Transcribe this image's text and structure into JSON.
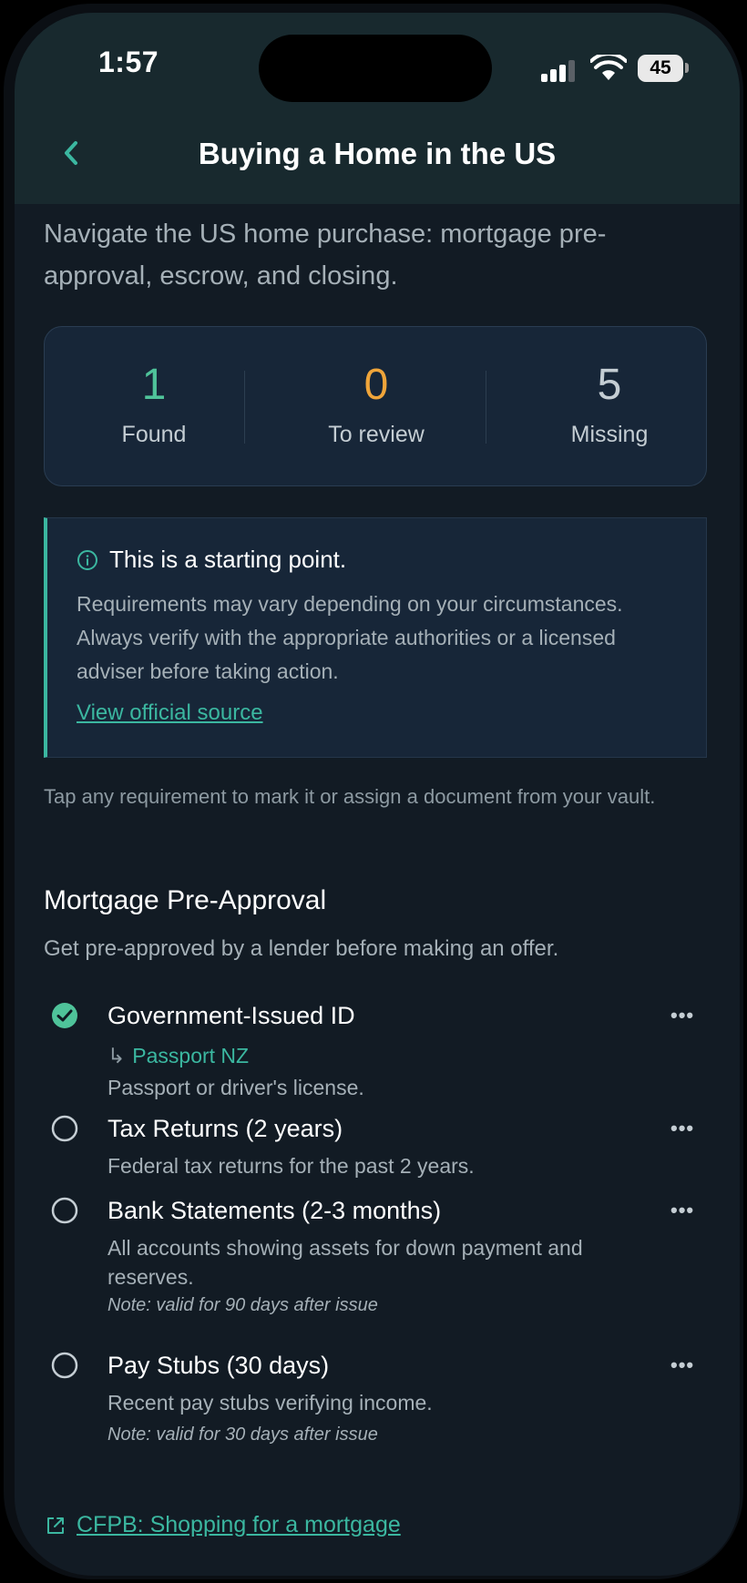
{
  "status_bar": {
    "time": "1:57",
    "battery": "45"
  },
  "header": {
    "title": "Buying a Home in the US"
  },
  "intro": "Navigate the US home purchase: mortgage pre-approval, escrow, and closing.",
  "stats": [
    {
      "value": "1",
      "label": "Found",
      "color": "#4fc39a"
    },
    {
      "value": "0",
      "label": "To review",
      "color": "#f0a53a"
    },
    {
      "value": "5",
      "label": "Missing",
      "color": "#c4cdd3"
    }
  ],
  "notice": {
    "title": "This is a starting point.",
    "body": "Requirements may vary depending on your circumstances. Always verify with the appropriate authorities or a licensed adviser before taking action.",
    "link": "View official source"
  },
  "tap_hint": "Tap any requirement to mark it or assign a document from your vault.",
  "section": {
    "title": "Mortgage Pre-Approval",
    "description": "Get pre-approved by a lender before making an offer.",
    "requirements": [
      {
        "name": "Government-Issued ID",
        "assigned": "Passport NZ",
        "description": "Passport or driver's license.",
        "done": true
      },
      {
        "name": "Tax Returns (2 years)",
        "description": "Federal tax returns for the past 2 years.",
        "done": false
      },
      {
        "name": "Bank Statements (2-3 months)",
        "description": "All accounts showing assets for down payment and reserves.",
        "note": "Note: valid for 90 days after issue",
        "done": false
      },
      {
        "name": "Pay Stubs (30 days)",
        "description": "Recent pay stubs verifying income.",
        "note": "Note: valid for 30 days after issue",
        "done": false
      }
    ]
  },
  "footer_link": "CFPB: Shopping for a mortgage",
  "colors": {
    "accent": "#3bb7a0",
    "found": "#4fc39a",
    "review": "#f0a53a"
  }
}
